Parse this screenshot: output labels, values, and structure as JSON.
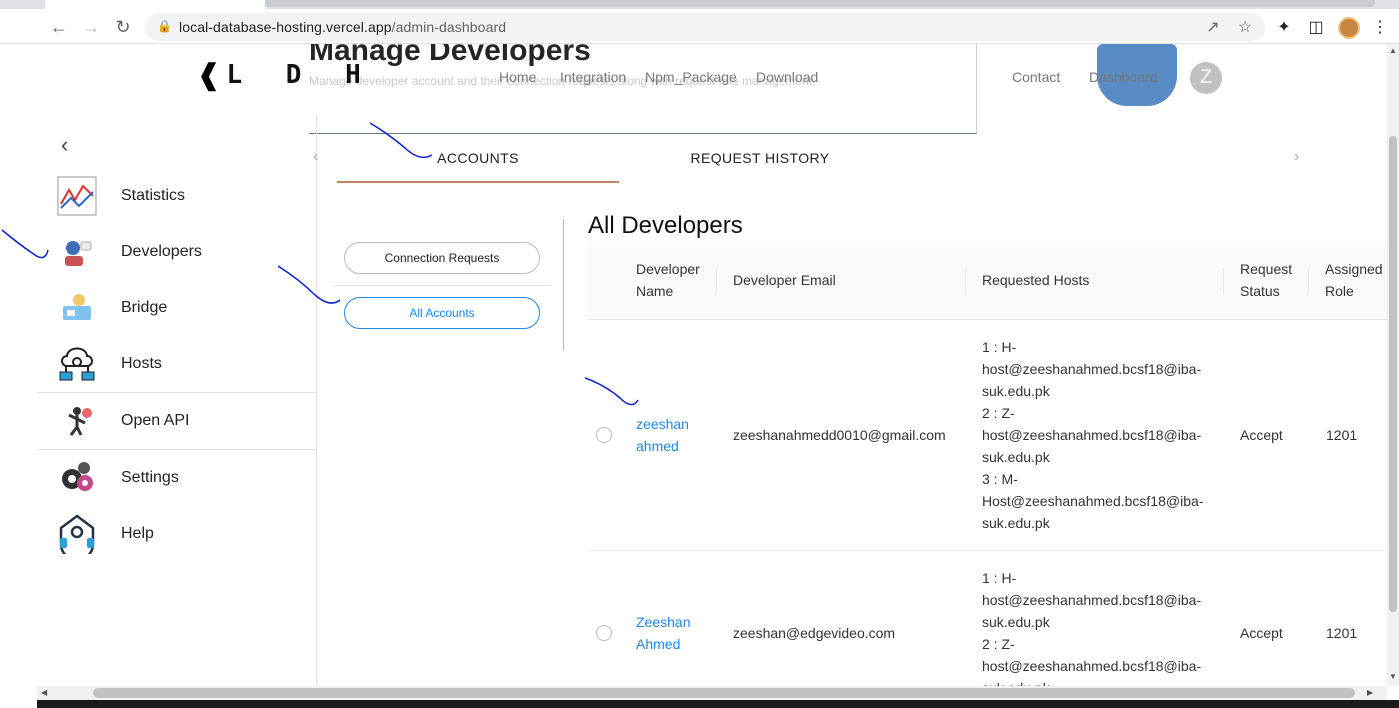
{
  "browser": {
    "url_host": "local-database-hosting.vercel.app",
    "url_path": "/admin-dashboard"
  },
  "ghost": {
    "title": "Manage Developers",
    "subtitle": "Manage developer account and their connection requests along with request role management"
  },
  "header": {
    "logo_text": "L D H",
    "nav": [
      "Home",
      "Integration",
      "Npm_Package",
      "Download",
      "Contact",
      "Dashboard"
    ],
    "avatar_letter": "Z"
  },
  "sidebar": {
    "items": [
      {
        "label": "Statistics",
        "icon": "chart-icon"
      },
      {
        "label": "Developers",
        "icon": "developer-icon"
      },
      {
        "label": "Bridge",
        "icon": "bridge-icon"
      },
      {
        "label": "Hosts",
        "icon": "hosts-icon"
      },
      {
        "label": "Open API",
        "icon": "open-api-icon"
      },
      {
        "label": "Settings",
        "icon": "settings-icon"
      },
      {
        "label": "Help",
        "icon": "help-icon"
      }
    ]
  },
  "tabs": [
    "ACCOUNTS",
    "REQUEST HISTORY"
  ],
  "filters": [
    "Connection Requests",
    "All Accounts"
  ],
  "table": {
    "title": "All Developers",
    "columns": [
      [
        "Developer",
        "Name"
      ],
      [
        "Developer Email"
      ],
      [
        "Requested Hosts"
      ],
      [
        "Request",
        "Status"
      ],
      [
        "Assigned",
        "Role"
      ]
    ],
    "rows": [
      {
        "name": [
          "zeeshan",
          "ahmed"
        ],
        "email": "zeeshanahmedd0010@gmail.com",
        "hosts": [
          "1 : H-",
          "host@zeeshanahmed.bcsf18@iba-",
          "suk.edu.pk",
          "2 : Z-",
          "host@zeeshanahmed.bcsf18@iba-",
          "suk.edu.pk",
          "3 : M-",
          "Host@zeeshanahmed.bcsf18@iba-",
          "suk.edu.pk"
        ],
        "status": "Accept",
        "role": "1201"
      },
      {
        "name": [
          "Zeeshan",
          "Ahmed"
        ],
        "email": "zeeshan@edgevideo.com",
        "hosts": [
          "1 : H-",
          "host@zeeshanahmed.bcsf18@iba-",
          "suk.edu.pk",
          "2 : Z-",
          "host@zeeshanahmed.bcsf18@iba-",
          "suk.edu.pk"
        ],
        "status": "Accept",
        "role": "1201"
      }
    ]
  },
  "colors": {
    "accent": "#1e88e5",
    "tab_underline": "#c08562",
    "ink": "#0a1fd6"
  }
}
